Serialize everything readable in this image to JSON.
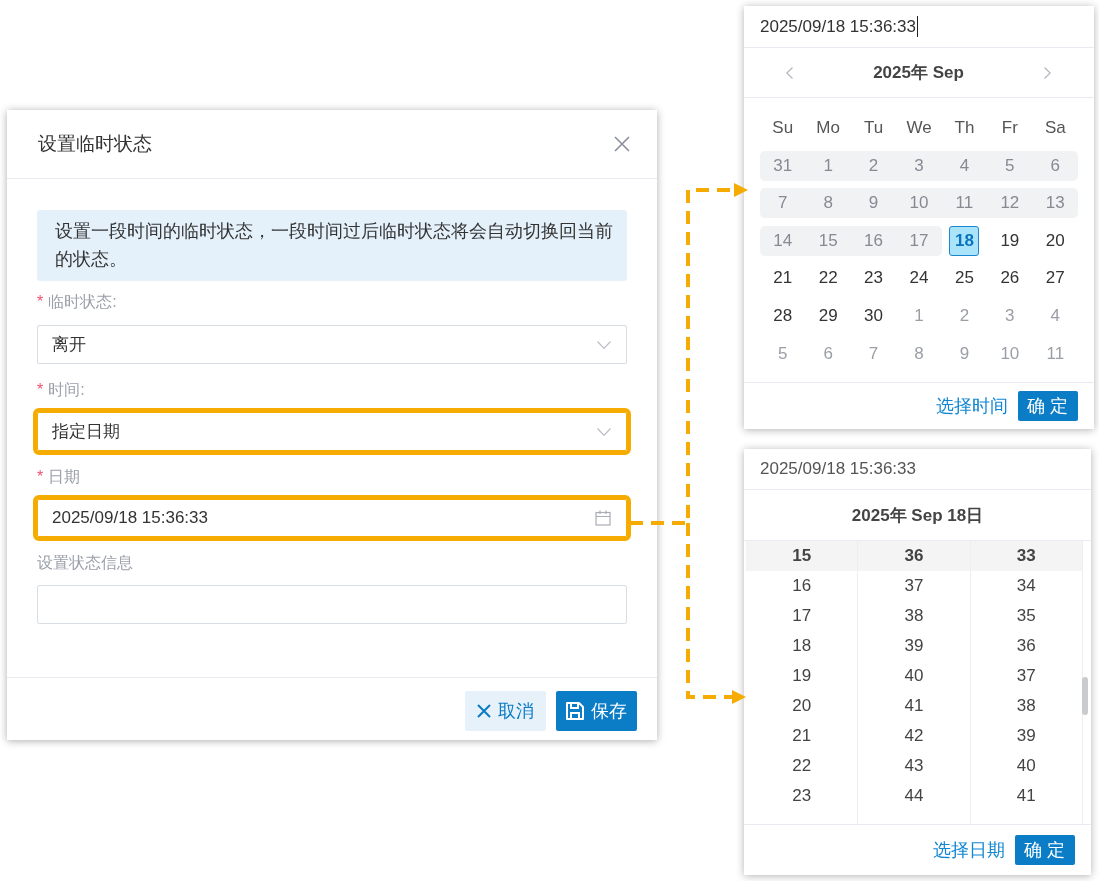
{
  "dialog": {
    "title": "设置临时状态",
    "notice": "设置一段时间的临时状态，一段时间过后临时状态将会自动切换回当前的状态。",
    "fields": [
      {
        "kind": "select",
        "mark": "*",
        "label": "临时状态:",
        "value": "离开",
        "highlighted": false
      },
      {
        "kind": "select",
        "mark": "*",
        "label": "时间:",
        "value": "指定日期",
        "highlighted": true
      },
      {
        "kind": "date",
        "mark": "*",
        "label": "日期",
        "value": "2025/09/18 15:36:33",
        "highlighted": true
      },
      {
        "kind": "text",
        "label": "设置状态信息",
        "highlighted": false
      }
    ],
    "buttons": [
      {
        "kind": "cancel",
        "label": "取消"
      },
      {
        "kind": "save",
        "label": "保存"
      }
    ]
  },
  "calendar_popup": {
    "input": {
      "value": "2025/09/18 15:36:33",
      "focused": true
    },
    "title": "2025年 Sep",
    "weekdays": [
      "Su",
      "Mo",
      "Tu",
      "We",
      "Th",
      "Fr",
      "Sa"
    ],
    "weeks": [
      [
        {
          "label": "31",
          "disabled": true,
          "muted": true,
          "selected": false
        },
        {
          "label": "1",
          "disabled": true,
          "muted": true,
          "selected": false
        },
        {
          "label": "2",
          "disabled": true,
          "muted": true,
          "selected": false
        },
        {
          "label": "3",
          "disabled": true,
          "muted": true,
          "selected": false
        },
        {
          "label": "4",
          "disabled": true,
          "muted": true,
          "selected": false
        },
        {
          "label": "5",
          "disabled": true,
          "muted": true,
          "selected": false
        },
        {
          "label": "6",
          "disabled": true,
          "muted": true,
          "selected": false
        }
      ],
      [
        {
          "label": "7",
          "disabled": true,
          "muted": true,
          "selected": false
        },
        {
          "label": "8",
          "disabled": true,
          "muted": true,
          "selected": false
        },
        {
          "label": "9",
          "disabled": true,
          "muted": true,
          "selected": false
        },
        {
          "label": "10",
          "disabled": true,
          "muted": true,
          "selected": false
        },
        {
          "label": "11",
          "disabled": true,
          "muted": true,
          "selected": false
        },
        {
          "label": "12",
          "disabled": true,
          "muted": true,
          "selected": false
        },
        {
          "label": "13",
          "disabled": true,
          "muted": true,
          "selected": false
        }
      ],
      [
        {
          "label": "14",
          "disabled": true,
          "muted": true,
          "selected": false
        },
        {
          "label": "15",
          "disabled": true,
          "muted": true,
          "selected": false
        },
        {
          "label": "16",
          "disabled": true,
          "muted": true,
          "selected": false
        },
        {
          "label": "17",
          "disabled": true,
          "muted": true,
          "selected": false
        },
        {
          "label": "18",
          "disabled": false,
          "muted": false,
          "selected": true
        },
        {
          "label": "19",
          "disabled": false,
          "muted": false,
          "selected": false
        },
        {
          "label": "20",
          "disabled": false,
          "muted": false,
          "selected": false
        }
      ],
      [
        {
          "label": "21",
          "disabled": false,
          "muted": false,
          "selected": false
        },
        {
          "label": "22",
          "disabled": false,
          "muted": false,
          "selected": false
        },
        {
          "label": "23",
          "disabled": false,
          "muted": false,
          "selected": false
        },
        {
          "label": "24",
          "disabled": false,
          "muted": false,
          "selected": false
        },
        {
          "label": "25",
          "disabled": false,
          "muted": false,
          "selected": false
        },
        {
          "label": "26",
          "disabled": false,
          "muted": false,
          "selected": false
        },
        {
          "label": "27",
          "disabled": false,
          "muted": false,
          "selected": false
        }
      ],
      [
        {
          "label": "28",
          "disabled": false,
          "muted": false,
          "selected": false
        },
        {
          "label": "29",
          "disabled": false,
          "muted": false,
          "selected": false
        },
        {
          "label": "30",
          "disabled": false,
          "muted": false,
          "selected": false
        },
        {
          "label": "1",
          "disabled": false,
          "muted": true,
          "selected": false
        },
        {
          "label": "2",
          "disabled": false,
          "muted": true,
          "selected": false
        },
        {
          "label": "3",
          "disabled": false,
          "muted": true,
          "selected": false
        },
        {
          "label": "4",
          "disabled": false,
          "muted": true,
          "selected": false
        }
      ],
      [
        {
          "label": "5",
          "disabled": false,
          "muted": true,
          "selected": false
        },
        {
          "label": "6",
          "disabled": false,
          "muted": true,
          "selected": false
        },
        {
          "label": "7",
          "disabled": false,
          "muted": true,
          "selected": false
        },
        {
          "label": "8",
          "disabled": false,
          "muted": true,
          "selected": false
        },
        {
          "label": "9",
          "disabled": false,
          "muted": true,
          "selected": false
        },
        {
          "label": "10",
          "disabled": false,
          "muted": true,
          "selected": false
        },
        {
          "label": "11",
          "disabled": false,
          "muted": true,
          "selected": false
        }
      ]
    ],
    "footer_link": "选择时间",
    "confirm_button": "确 定"
  },
  "time_popup": {
    "input": {
      "value": "2025/09/18 15:36:33",
      "focused": false
    },
    "title": "2025年 Sep 18日",
    "columns": [
      [
        {
          "label": "15",
          "selected": true
        },
        {
          "label": "16",
          "selected": false
        },
        {
          "label": "17",
          "selected": false
        },
        {
          "label": "18",
          "selected": false
        },
        {
          "label": "19",
          "selected": false
        },
        {
          "label": "20",
          "selected": false
        },
        {
          "label": "21",
          "selected": false
        },
        {
          "label": "22",
          "selected": false
        },
        {
          "label": "23",
          "selected": false
        }
      ],
      [
        {
          "label": "36",
          "selected": true
        },
        {
          "label": "37",
          "selected": false
        },
        {
          "label": "38",
          "selected": false
        },
        {
          "label": "39",
          "selected": false
        },
        {
          "label": "40",
          "selected": false
        },
        {
          "label": "41",
          "selected": false
        },
        {
          "label": "42",
          "selected": false
        },
        {
          "label": "43",
          "selected": false
        },
        {
          "label": "44",
          "selected": false
        }
      ],
      [
        {
          "label": "33",
          "selected": true
        },
        {
          "label": "34",
          "selected": false
        },
        {
          "label": "35",
          "selected": false
        },
        {
          "label": "36",
          "selected": false
        },
        {
          "label": "37",
          "selected": false
        },
        {
          "label": "38",
          "selected": false
        },
        {
          "label": "39",
          "selected": false
        },
        {
          "label": "40",
          "selected": false
        },
        {
          "label": "41",
          "selected": false
        }
      ]
    ],
    "footer_link": "选择日期",
    "confirm_button": "确 定"
  }
}
